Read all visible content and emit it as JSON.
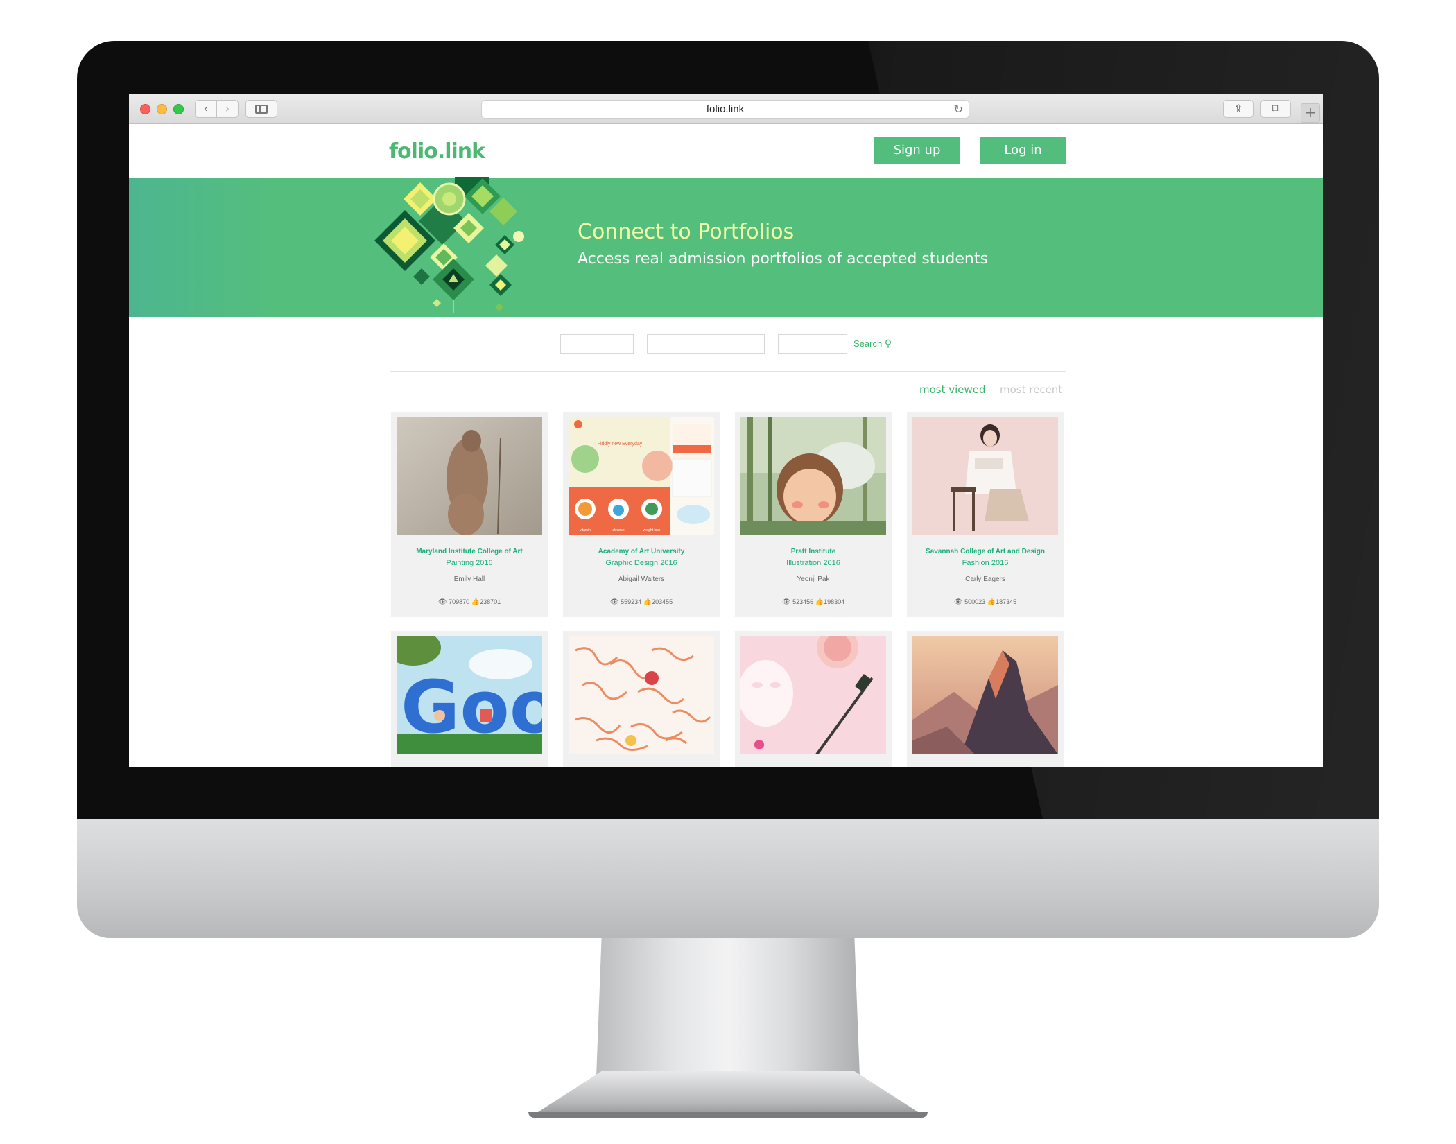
{
  "browser": {
    "url": "folio.link"
  },
  "site": {
    "logo_text": "folio.link",
    "signup_label": "Sign up",
    "login_label": "Log in"
  },
  "hero": {
    "title": "Connect to Portfolios",
    "subtitle": "Access real admission portfolios of accepted students"
  },
  "search": {
    "button_label": "Search"
  },
  "sort": {
    "most_viewed": "most viewed",
    "most_recent": "most recent"
  },
  "colors": {
    "brand_green": "#52bd7d",
    "hero_title": "#f2ffa8",
    "link_green": "#1eae7a"
  },
  "cards": [
    {
      "school": "Maryland Institute College of Art",
      "program": "Painting 2016",
      "student": "Emily Hall",
      "views": "709870",
      "likes": "238701"
    },
    {
      "school": "Academy of Art University",
      "program": "Graphic Design 2016",
      "student": "Abigail Walters",
      "views": "559234",
      "likes": "203455"
    },
    {
      "school": "Pratt Institute",
      "program": "Illustration 2016",
      "student": "Yeonji Pak",
      "views": "523456",
      "likes": "198304"
    },
    {
      "school": "Savannah College of Art and Design",
      "program": "Fashion 2016",
      "student": "Carly Eagers",
      "views": "500023",
      "likes": "187345"
    }
  ],
  "thumb_inner_texts": {
    "card2_tagline": "Fiddly new Everyday",
    "card2_labels": [
      "vitamin",
      "cleanse",
      "weight loss"
    ],
    "card5_letters": "Goo"
  }
}
